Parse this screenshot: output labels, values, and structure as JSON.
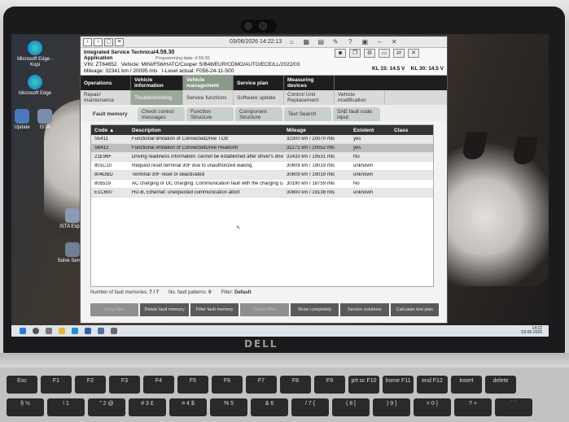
{
  "app": {
    "title_line1": "Integrated Service Technical",
    "title_line2": "Application",
    "version": "4.59.30",
    "programming_data": "Programming data: 4.59.30",
    "datetime": "03/06/2026 14:22:13",
    "vin_label": "VIN:",
    "vin": "ZT64652",
    "vehicle_label": "Vehicle:",
    "vehicle": "MINI/F56/HATC/Cooper S/B48/EUR/CDMO/AUTO/ECE/LL/2022/03",
    "mileage_label": "Mileage:",
    "mileage": "32341 km / 20095 mls",
    "ilevel_label": "I-Level actual:",
    "ilevel": "F056-24-11-500",
    "kl15": "KL 15: 14.5 V",
    "kl30": "KL 30: 14.5 V"
  },
  "main_nav": [
    {
      "label": "Operations"
    },
    {
      "label": "Vehicle information"
    },
    {
      "label": "Vehicle management"
    },
    {
      "label": "Service plan"
    },
    {
      "label": "Measuring devices"
    }
  ],
  "sub_nav": [
    {
      "label": "Repair/ maintenance"
    },
    {
      "label": "Troubleshooting"
    },
    {
      "label": "Service functions"
    },
    {
      "label": "Software update"
    },
    {
      "label": "Control Unit Replacement"
    },
    {
      "label": "Vehicle modification"
    }
  ],
  "tabs": [
    {
      "label": "Fault memory"
    },
    {
      "label": "Check control messages"
    },
    {
      "label": "Function Structure"
    },
    {
      "label": "Component Structure"
    },
    {
      "label": "Text Search"
    },
    {
      "label": "SAE fault code input"
    }
  ],
  "table": {
    "columns": [
      "Code ▲",
      "Description",
      "Mileage",
      "Existent",
      "Class"
    ],
    "rows": [
      {
        "code": "S5411",
        "description": "Functional limitation of ConnectedDrive TCB",
        "mileage": "32300 km / 20070 mls",
        "existent": "yes",
        "class": ""
      },
      {
        "code": "S8412",
        "description": "Functional limitation of ConnectedDrive Headunit",
        "mileage": "32272 km / 20052 mls",
        "existent": "yes",
        "class": ""
      },
      {
        "code": "21E96F",
        "description": "Driving readiness information: cannot be established after driver's drivin",
        "mileage": "31433 km / 19531 mls",
        "existent": "No",
        "class": ""
      },
      {
        "code": "801C10",
        "description": "Request reset terminal 30F due to unauthorized waking",
        "mileage": "30609 km / 19019 mls",
        "existent": "unknown",
        "class": ""
      },
      {
        "code": "804DBD",
        "description": "Terminal 30F reset or deactivated",
        "mileage": "30609 km / 19019 mls",
        "existent": "unknown",
        "class": ""
      },
      {
        "code": "805519",
        "description": "AC charging or DC charging: Communication fault with the charging ca",
        "mileage": "30190 km / 18759 mls",
        "existent": "No",
        "class": ""
      },
      {
        "code": "E1C600",
        "description": "HU-B, Ethernet: unexpected communication abort",
        "mileage": "30800 km / 19138 mls",
        "existent": "unknown",
        "class": ""
      }
    ]
  },
  "status": {
    "fault_memories_label": "Number of fault memories:",
    "fault_memories": "7 / 7",
    "fault_patterns_label": "No. fault patterns:",
    "fault_patterns": "0",
    "filter_label": "Filter:",
    "filter": "Default"
  },
  "buttons": [
    {
      "label": "Show filter",
      "enabled": false
    },
    {
      "label": "Delete fault memory",
      "enabled": true
    },
    {
      "label": "Filter fault memory",
      "enabled": true
    },
    {
      "label": "Delete filter",
      "enabled": false
    },
    {
      "label": "Show completely",
      "enabled": true
    },
    {
      "label": "Service solutions",
      "enabled": true
    },
    {
      "label": "Calculate test plan",
      "enabled": true
    }
  ],
  "desktop_icons": [
    {
      "label": "Microsoft Edge - Kopi"
    },
    {
      "label": "Microsoft Edge"
    },
    {
      "label": "Update"
    },
    {
      "label": "ISTA"
    },
    {
      "label": "ISTA Expert"
    },
    {
      "label": "Solve Service"
    }
  ],
  "taskbar": {
    "time": "14:22",
    "date": "03-06-2026"
  },
  "brand": "DELL",
  "keyboard_row1": [
    "Esc",
    "F1",
    "F2",
    "F3",
    "F4",
    "F5",
    "F6",
    "F7",
    "F8",
    "F9",
    "prt sc F10",
    "home F11",
    "end F12",
    "insert",
    "delete"
  ],
  "keyboard_row2": [
    "§ ½",
    "! 1",
    "\" 2 @",
    "# 3 £",
    "¤ 4 $",
    "% 5",
    "& 6",
    "/ 7 {",
    "( 8 [",
    ") 9 ]",
    "= 0 }",
    "? +",
    "` ´"
  ]
}
